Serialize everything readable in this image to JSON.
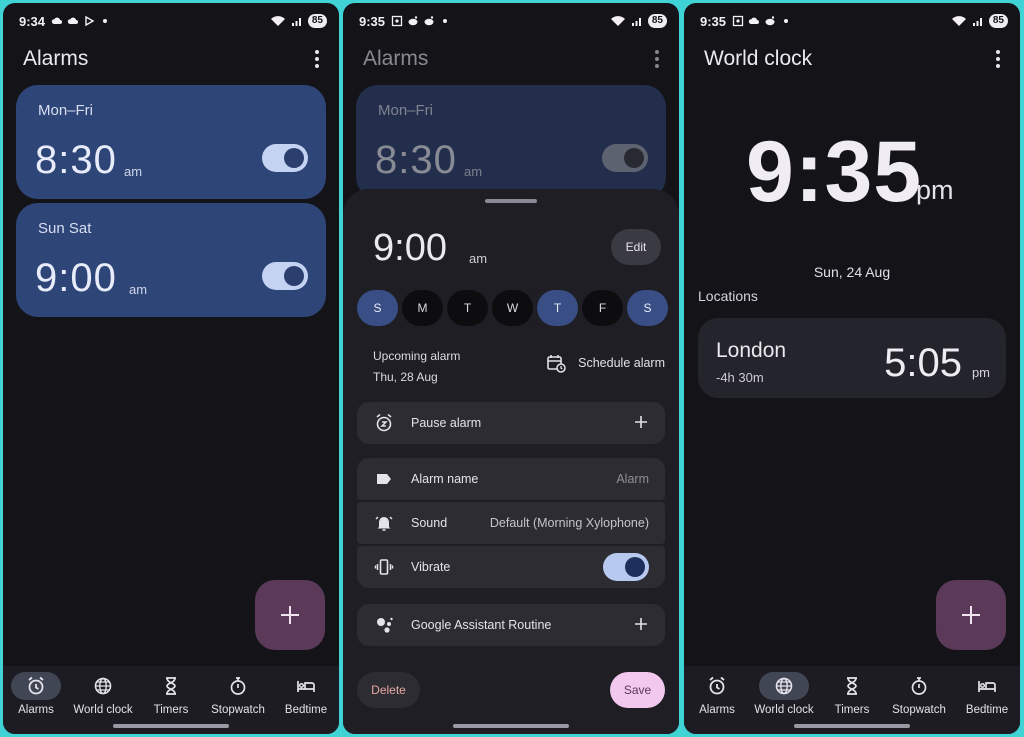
{
  "colors": {
    "frame": "#3fd3d6",
    "screen_bg": "#141318",
    "alarm_card": "#2e4577",
    "fab": "#5a3a58",
    "save": "#f2c8ef",
    "delete_text": "#e7a9a3"
  },
  "screens": [
    {
      "status": {
        "time": "9:34",
        "battery": "85"
      },
      "title": "Alarms",
      "alarms": [
        {
          "days": "Mon–Fri",
          "time": "8:30",
          "ampm": "am",
          "enabled": true
        },
        {
          "days": "Sun Sat",
          "time": "9:00",
          "ampm": "am",
          "enabled": true
        }
      ],
      "fab_icon": "plus-icon",
      "nav": [
        {
          "label": "Alarms",
          "icon": "alarm-icon",
          "active": true
        },
        {
          "label": "World clock",
          "icon": "globe-icon",
          "active": false
        },
        {
          "label": "Timers",
          "icon": "hourglass-icon",
          "active": false
        },
        {
          "label": "Stopwatch",
          "icon": "stopwatch-icon",
          "active": false
        },
        {
          "label": "Bedtime",
          "icon": "bed-icon",
          "active": false
        }
      ]
    },
    {
      "status": {
        "time": "9:35",
        "battery": "85"
      },
      "title": "Alarms",
      "background_alarm": {
        "days": "Mon–Fri",
        "time": "8:30",
        "ampm": "am"
      },
      "editor": {
        "time": "9:00",
        "ampm": "am",
        "edit_label": "Edit",
        "days": [
          {
            "letter": "S",
            "on": true
          },
          {
            "letter": "M",
            "on": false
          },
          {
            "letter": "T",
            "on": false
          },
          {
            "letter": "W",
            "on": false
          },
          {
            "letter": "T",
            "on": true
          },
          {
            "letter": "F",
            "on": false
          },
          {
            "letter": "S",
            "on": true
          }
        ],
        "upcoming_label": "Upcoming alarm",
        "upcoming_date": "Thu, 28 Aug",
        "schedule_label": "Schedule alarm",
        "pause_label": "Pause alarm",
        "alarm_name_label": "Alarm name",
        "alarm_name_value": "Alarm",
        "sound_label": "Sound",
        "sound_value": "Default (Morning Xylophone)",
        "vibrate_label": "Vibrate",
        "vibrate_on": true,
        "assistant_label": "Google Assistant Routine",
        "delete_label": "Delete",
        "save_label": "Save"
      }
    },
    {
      "status": {
        "time": "9:35",
        "battery": "85"
      },
      "title": "World clock",
      "clock_time": "9:35",
      "clock_ampm": "pm",
      "date": "Sun, 24 Aug",
      "locations_label": "Locations",
      "city": {
        "name": "London",
        "offset": "-4h 30m",
        "time": "5:05",
        "ampm": "pm"
      },
      "fab_icon": "plus-icon",
      "nav": [
        {
          "label": "Alarms",
          "icon": "alarm-icon",
          "active": false
        },
        {
          "label": "World clock",
          "icon": "globe-icon",
          "active": true
        },
        {
          "label": "Timers",
          "icon": "hourglass-icon",
          "active": false
        },
        {
          "label": "Stopwatch",
          "icon": "stopwatch-icon",
          "active": false
        },
        {
          "label": "Bedtime",
          "icon": "bed-icon",
          "active": false
        }
      ]
    }
  ]
}
